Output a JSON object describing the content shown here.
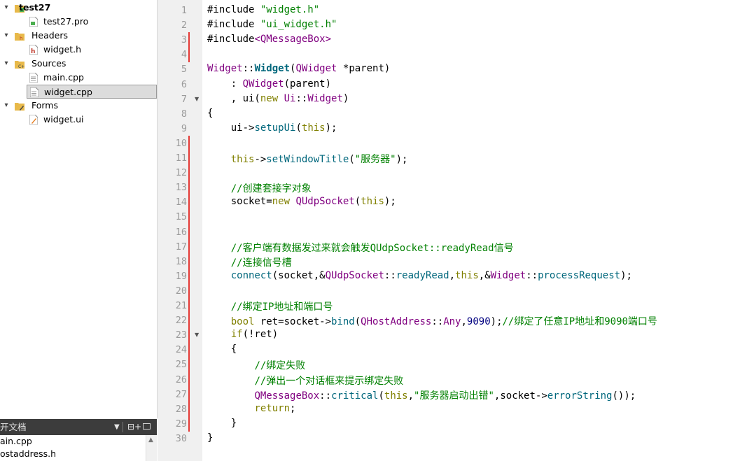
{
  "project_tree": {
    "root": "test27",
    "items": [
      {
        "label": "test27",
        "kind": "project",
        "icon": "qt-project-folder-icon",
        "expanded": true
      },
      {
        "label": "test27.pro",
        "kind": "file",
        "icon": "pro-file-icon"
      },
      {
        "label": "Headers",
        "kind": "folder",
        "icon": "headers-folder-icon",
        "expanded": true
      },
      {
        "label": "widget.h",
        "kind": "file",
        "icon": "header-file-icon"
      },
      {
        "label": "Sources",
        "kind": "folder",
        "icon": "sources-folder-icon",
        "expanded": true
      },
      {
        "label": "main.cpp",
        "kind": "file",
        "icon": "cpp-file-icon"
      },
      {
        "label": "widget.cpp",
        "kind": "file",
        "icon": "cpp-file-icon",
        "selected": true
      },
      {
        "label": "Forms",
        "kind": "folder",
        "icon": "forms-folder-icon",
        "expanded": true
      },
      {
        "label": "widget.ui",
        "kind": "file",
        "icon": "ui-file-icon"
      }
    ]
  },
  "open_documents": {
    "title": "开文档",
    "items": [
      "ain.cpp",
      "ostaddress.h"
    ]
  },
  "editor": {
    "first_line": 1,
    "lines": [
      "#include \"widget.h\"",
      "#include \"ui_widget.h\"",
      "#include<QMessageBox>",
      "",
      "Widget::Widget(QWidget *parent)",
      "    : QWidget(parent)",
      "    , ui(new Ui::Widget)",
      "{",
      "    ui->setupUi(this);",
      "",
      "    this->setWindowTitle(\"服务器\");",
      "",
      "    //创建套接字对象",
      "    socket=new QUdpSocket(this);",
      "",
      "",
      "    //客户端有数据发过来就会触发QUdpSocket::readyRead信号",
      "    //连接信号槽",
      "    connect(socket,&QUdpSocket::readyRead,this,&Widget::processRequest);",
      "",
      "    //绑定IP地址和端口号",
      "    bool ret=socket->bind(QHostAddress::Any,9090);//绑定了任意IP地址和9090端口号",
      "    if(!ret)",
      "    {",
      "        //绑定失败",
      "        //弹出一个对话框来提示绑定失败",
      "        QMessageBox::critical(this,\"服务器启动出错\",socket->errorString());",
      "        return;",
      "    }",
      "}"
    ],
    "modified_lines": [
      3,
      4,
      10,
      11,
      12,
      13,
      14,
      15,
      16,
      17,
      18,
      19,
      20,
      21,
      22,
      23,
      24,
      25,
      26,
      27,
      28,
      29
    ],
    "fold_markers": [
      7,
      23
    ],
    "colors": {
      "keyword": "#808000",
      "string": "#008000",
      "comment": "#008000",
      "type": "#800080",
      "function": "#00677c",
      "number": "#000080",
      "change_marker": "#e53935"
    }
  }
}
